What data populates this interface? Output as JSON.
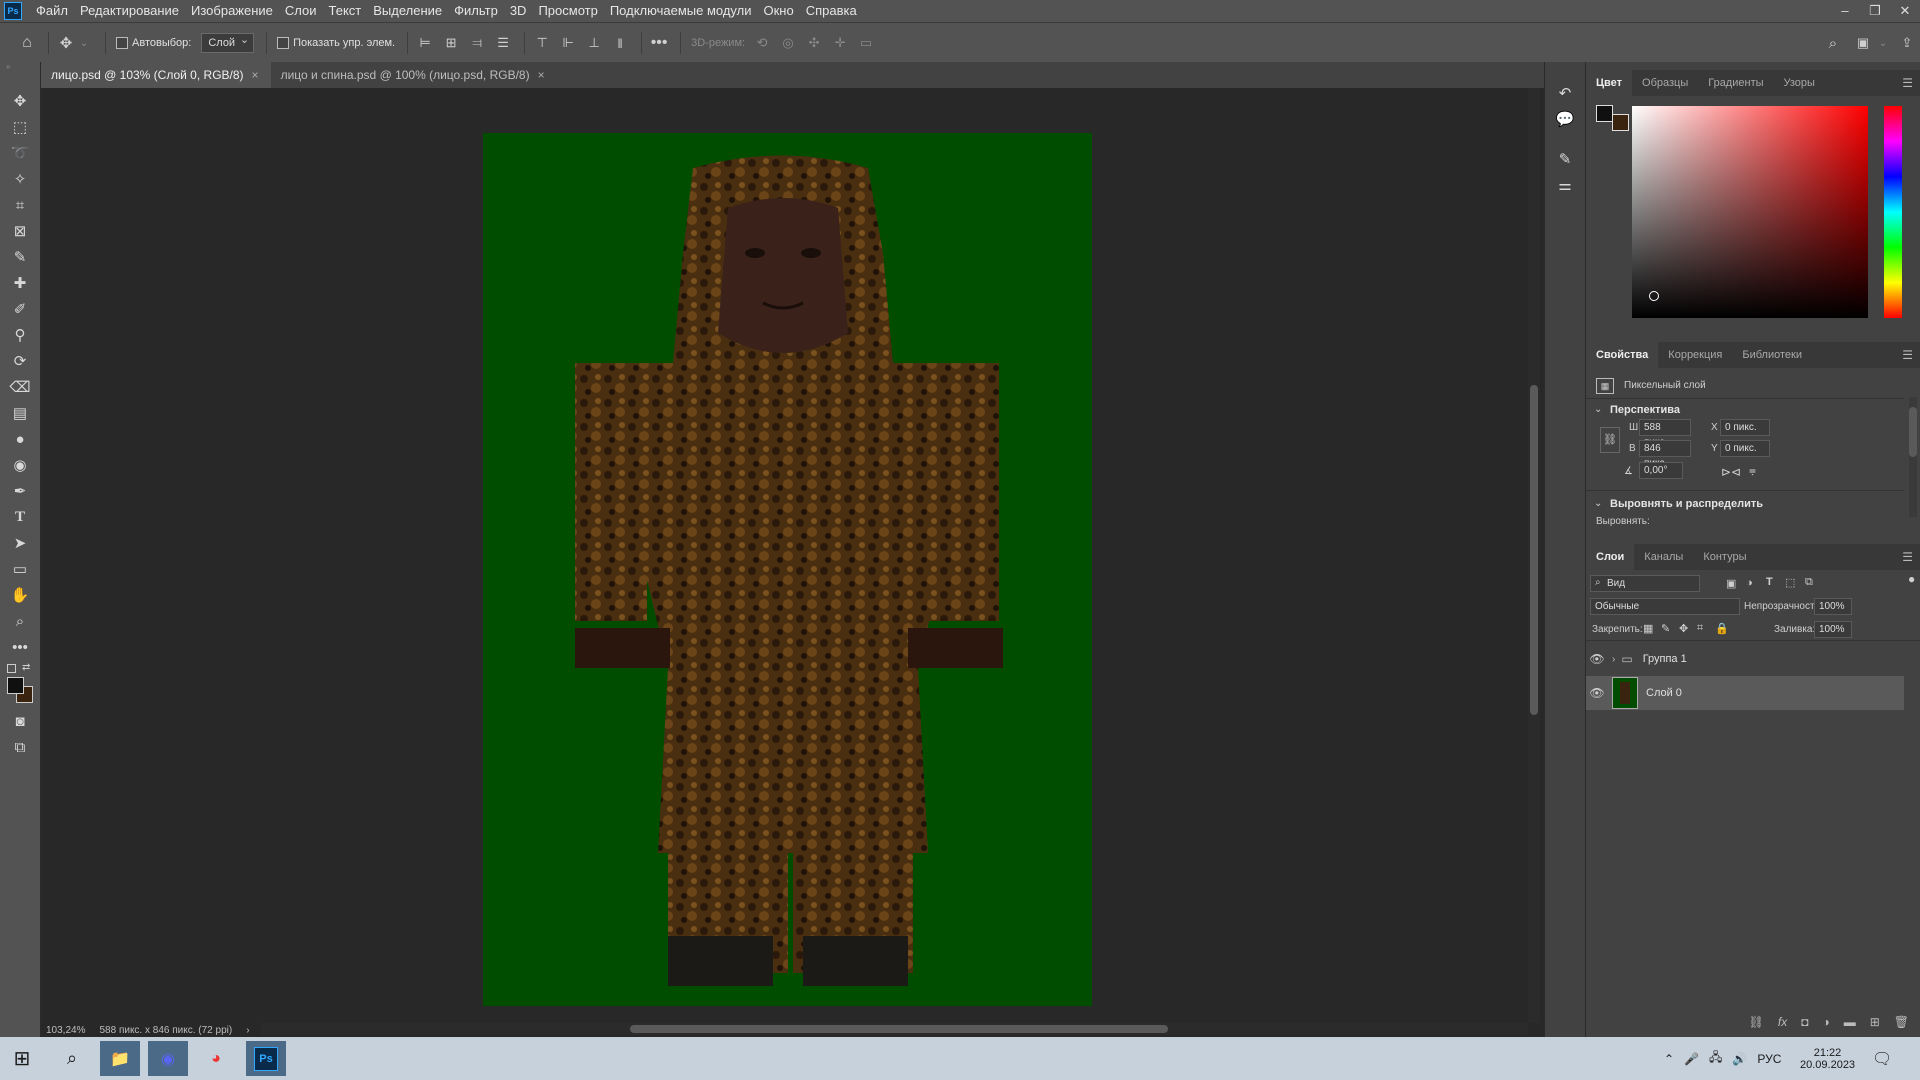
{
  "app": {
    "logo": "Ps"
  },
  "menu": [
    "Файл",
    "Редактирование",
    "Изображение",
    "Слои",
    "Текст",
    "Выделение",
    "Фильтр",
    "3D",
    "Просмотр",
    "Подключаемые модули",
    "Окно",
    "Справка"
  ],
  "window_controls": [
    "–",
    "❐",
    "✕"
  ],
  "options": {
    "autoselect_label": "Автовыбор:",
    "autoselect_value": "Слой",
    "show_transform_label": "Показать упр. элем.",
    "mode_3d_label": "3D-режим:"
  },
  "tabs": [
    {
      "label": "лицо.psd @ 103% (Слой 0, RGB/8)",
      "close": "×"
    },
    {
      "label": "лицо и спина.psd @ 100% (лицо.psd, RGB/8)",
      "close": "×"
    }
  ],
  "status": {
    "zoom": "103,24%",
    "doc_info": "588 пикс. x 846 пикс. (72 ppi)",
    "arrow": "›"
  },
  "color_panel": {
    "tabs": [
      "Цвет",
      "Образцы",
      "Градиенты",
      "Узоры"
    ],
    "foreground": "#101010",
    "background": "#3a2410",
    "hue_color": "#ff0000"
  },
  "properties_panel": {
    "tabs": [
      "Свойства",
      "Коррекция",
      "Библиотеки"
    ],
    "layer_type": "Пиксельный слой",
    "section_transform": "Перспектива",
    "w_label": "Ш",
    "w_value": "588 пикс.",
    "h_label": "В",
    "h_value": "846 пикс.",
    "x_label": "X",
    "x_value": "0 пикс.",
    "y_label": "Y",
    "y_value": "0 пикс.",
    "angle_value": "0,00°",
    "section_align": "Выровнять и распределить",
    "align_label": "Выровнять:"
  },
  "layers_panel": {
    "tabs": [
      "Слои",
      "Каналы",
      "Контуры"
    ],
    "filter_value": "Вид",
    "blend_mode": "Обычные",
    "opacity_label": "Непрозрачность:",
    "opacity_value": "100%",
    "lock_label": "Закрепить:",
    "fill_label": "Заливка:",
    "fill_value": "100%",
    "layers": [
      {
        "name": "Группа 1",
        "type": "group"
      },
      {
        "name": "Слой 0",
        "type": "pixel",
        "selected": true
      }
    ]
  },
  "taskbar": {
    "lang": "РУС",
    "time": "21:22",
    "date": "20.09.2023",
    "ps_label": "Ps"
  }
}
